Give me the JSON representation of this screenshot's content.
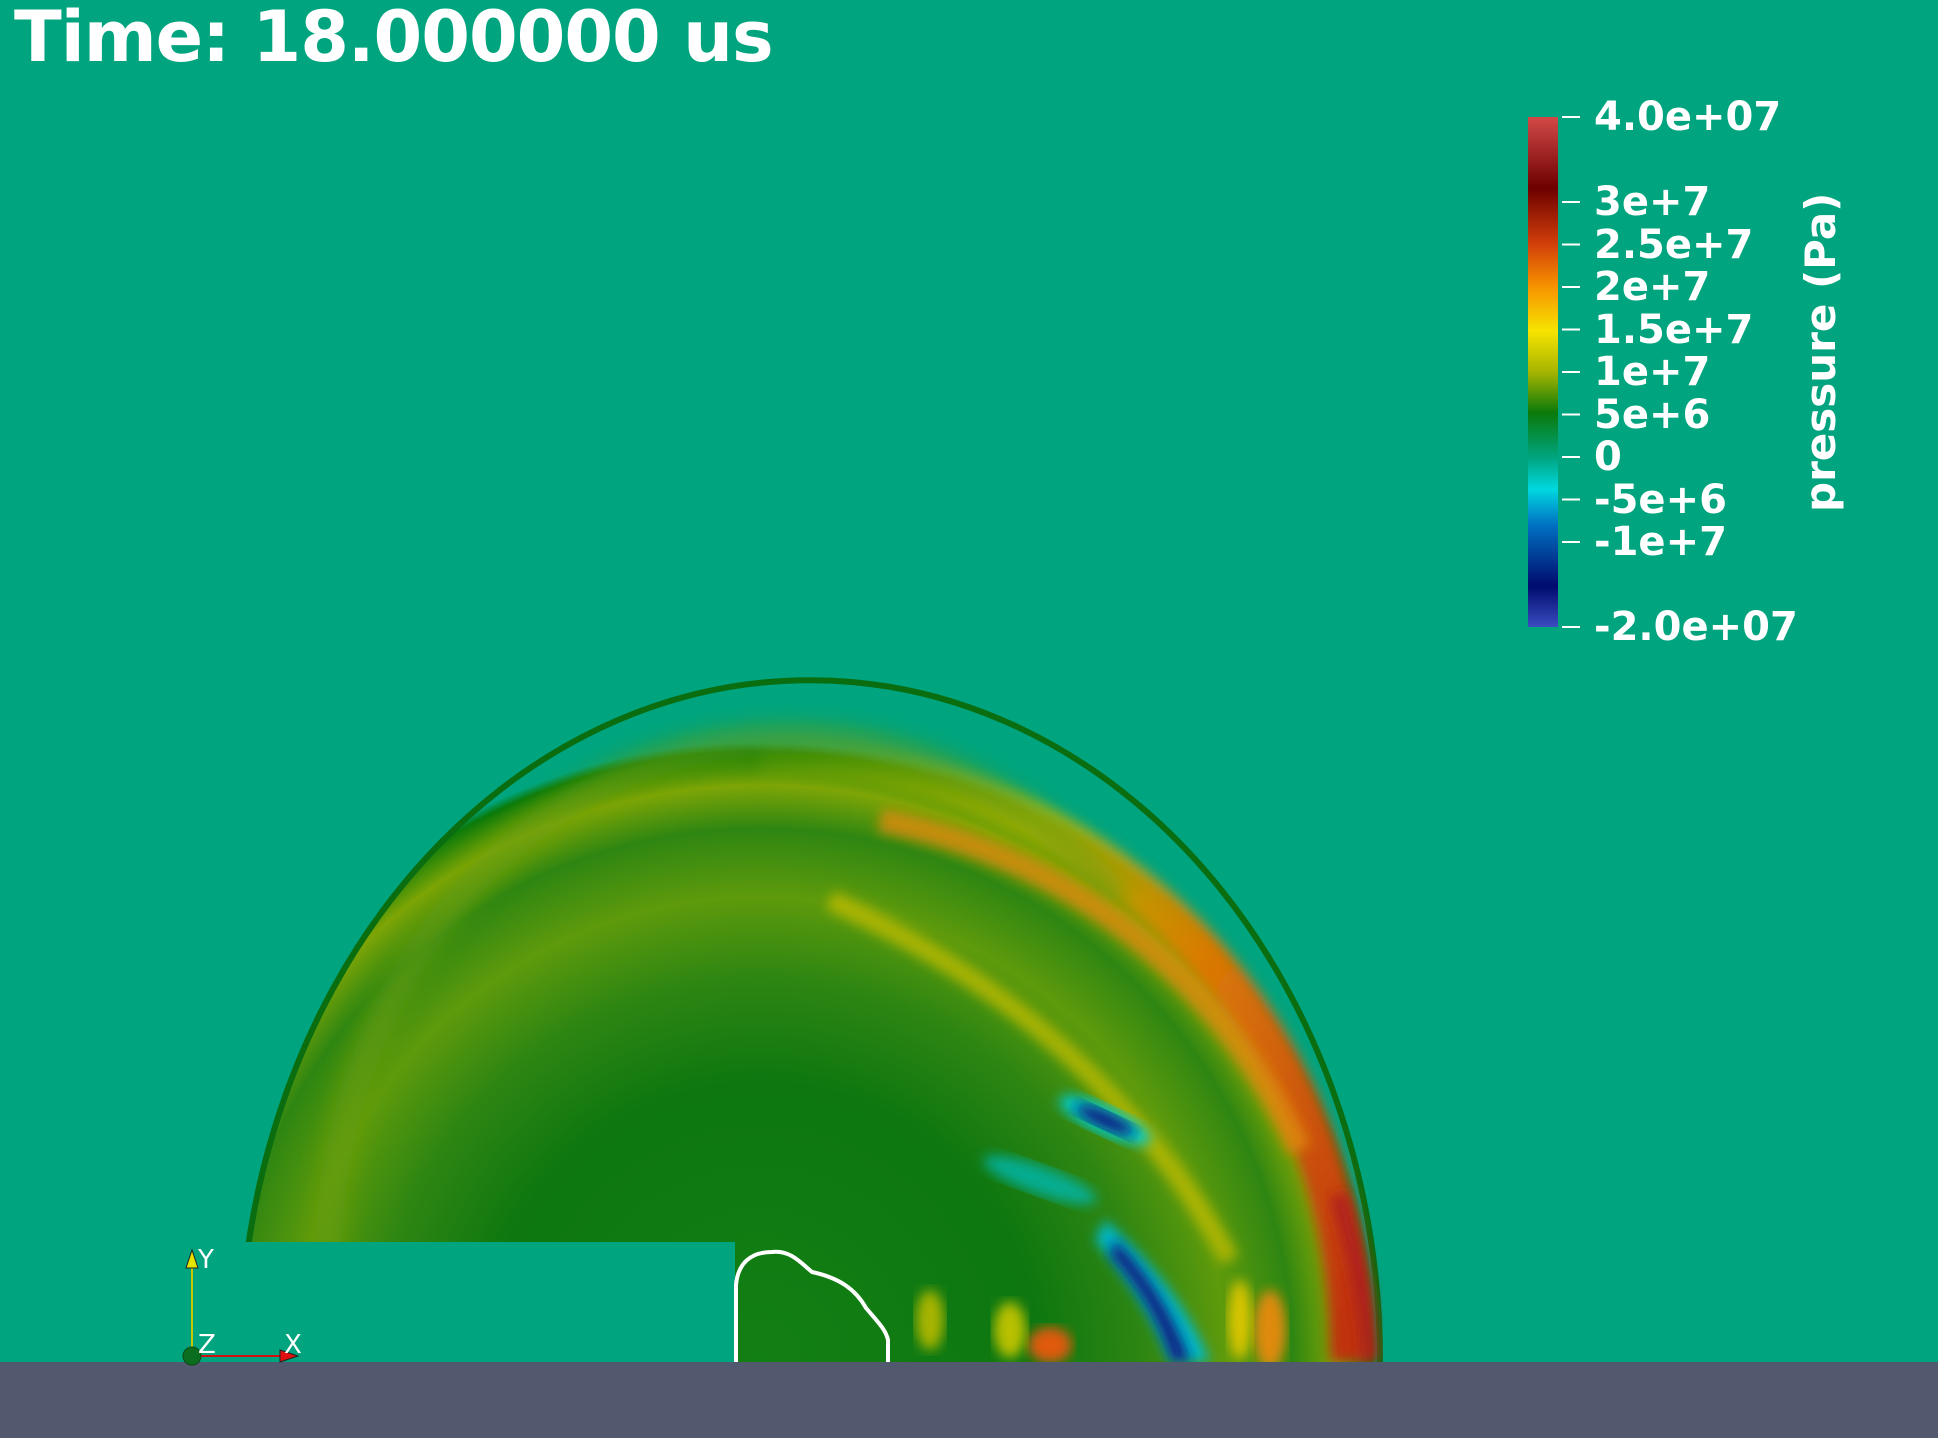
{
  "time_annotation": "Time: 18.000000 us",
  "colorbar": {
    "title": "pressure (Pa)",
    "ticks": [
      {
        "label": "4.0e+07",
        "value": 40000000
      },
      {
        "label": "3e+7",
        "value": 30000000
      },
      {
        "label": "2.5e+7",
        "value": 25000000
      },
      {
        "label": "2e+7",
        "value": 20000000
      },
      {
        "label": "1.5e+7",
        "value": 15000000
      },
      {
        "label": "1e+7",
        "value": 10000000
      },
      {
        "label": "5e+6",
        "value": 5000000
      },
      {
        "label": "0",
        "value": 0
      },
      {
        "label": "-5e+6",
        "value": -5000000
      },
      {
        "label": "-1e+7",
        "value": -10000000
      },
      {
        "label": "-2.0e+07",
        "value": -20000000
      }
    ],
    "range": [
      -20000000,
      40000000
    ],
    "colormap": "jet-like",
    "colors": [
      "#3A4CC0",
      "#000B6E",
      "#0071C2",
      "#00D8E0",
      "#00A47E",
      "#0A7A0A",
      "#A6B400",
      "#F6E400",
      "#F69000",
      "#D2400A",
      "#6E0000",
      "#D24A48"
    ]
  },
  "axes_triad": {
    "x_label": "X",
    "y_label": "Y",
    "z_label": "Z"
  },
  "colors": {
    "background": "#00A47E",
    "ground": "#52586E",
    "contour": "#FFFFFF"
  }
}
